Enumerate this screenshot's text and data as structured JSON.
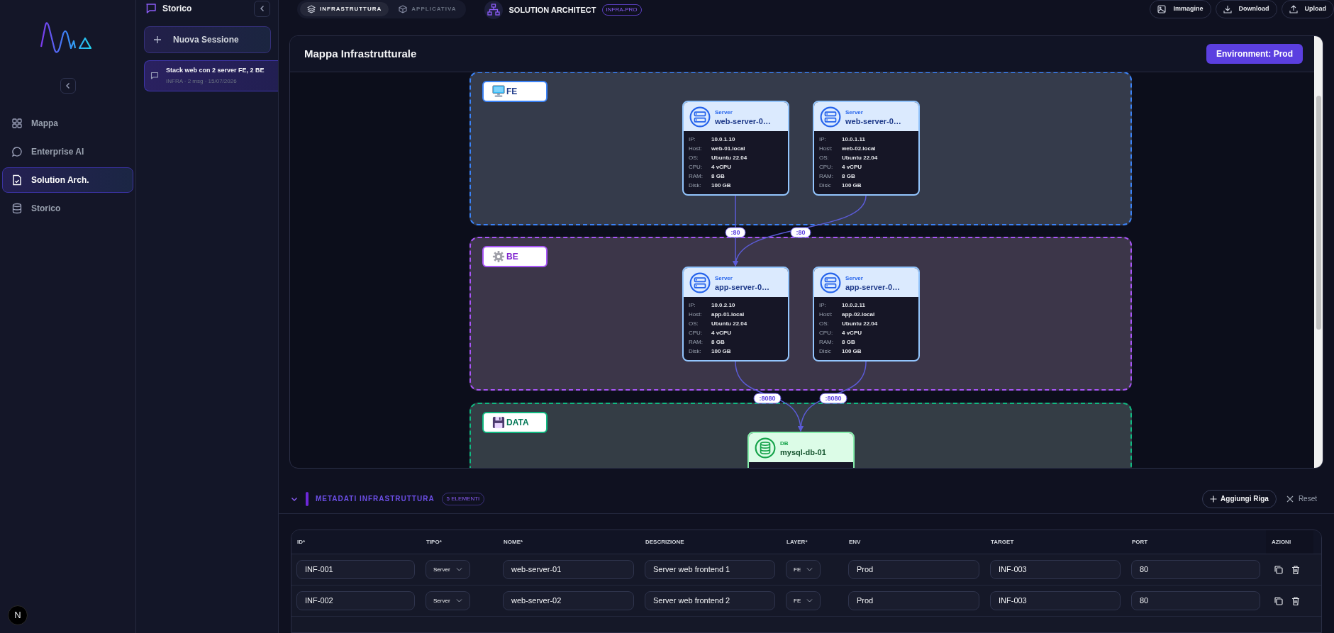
{
  "nav": {
    "items": [
      {
        "label": "Mappa",
        "selected": false
      },
      {
        "label": "Enterprise AI",
        "selected": false
      },
      {
        "label": "Solution Arch.",
        "selected": true
      },
      {
        "label": "Storico",
        "selected": false
      }
    ],
    "avatar": "N"
  },
  "history": {
    "title": "Storico",
    "new_session": "Nuova Sessione",
    "sessions": [
      {
        "title": "Stack web con 2 server FE, 2 BE",
        "meta": "INFRA · 2 msg · 15/07/2026",
        "selected": true
      }
    ]
  },
  "topbar": {
    "view_tabs": [
      {
        "label": "INFRASTRUTTURA",
        "selected": true
      },
      {
        "label": "APPLICATIVA",
        "selected": false
      }
    ],
    "title": "SOLUTION ARCHITECT",
    "badge": "INFRA-PRO",
    "actions": [
      {
        "label": "Immagine"
      },
      {
        "label": "Download"
      },
      {
        "label": "Upload"
      }
    ]
  },
  "map": {
    "title": "Mappa Infrastrutturale",
    "environment": "Environment: Prod",
    "groups": [
      {
        "label": "FE",
        "kind": "fe"
      },
      {
        "label": "BE",
        "kind": "be"
      },
      {
        "label": "DATA",
        "kind": "data"
      }
    ],
    "nodes": [
      {
        "type": "Server",
        "name": "web-server-0…",
        "kind": "server",
        "fields": [
          {
            "label": "IP:",
            "value": "10.0.1.10"
          },
          {
            "label": "Host:",
            "value": "web-01.local"
          },
          {
            "label": "OS:",
            "value": "Ubuntu 22.04"
          },
          {
            "label": "CPU:",
            "value": "4 vCPU"
          },
          {
            "label": "RAM:",
            "value": "8 GB"
          },
          {
            "label": "Disk:",
            "value": "100 GB"
          }
        ]
      },
      {
        "type": "Server",
        "name": "web-server-0…",
        "kind": "server",
        "fields": [
          {
            "label": "IP:",
            "value": "10.0.1.11"
          },
          {
            "label": "Host:",
            "value": "web-02.local"
          },
          {
            "label": "OS:",
            "value": "Ubuntu 22.04"
          },
          {
            "label": "CPU:",
            "value": "4 vCPU"
          },
          {
            "label": "RAM:",
            "value": "8 GB"
          },
          {
            "label": "Disk:",
            "value": "100 GB"
          }
        ]
      },
      {
        "type": "Server",
        "name": "app-server-0…",
        "kind": "server",
        "fields": [
          {
            "label": "IP:",
            "value": "10.0.2.10"
          },
          {
            "label": "Host:",
            "value": "app-01.local"
          },
          {
            "label": "OS:",
            "value": "Ubuntu 22.04"
          },
          {
            "label": "CPU:",
            "value": "4 vCPU"
          },
          {
            "label": "RAM:",
            "value": "8 GB"
          },
          {
            "label": "Disk:",
            "value": "100 GB"
          }
        ]
      },
      {
        "type": "Server",
        "name": "app-server-0…",
        "kind": "server",
        "fields": [
          {
            "label": "IP:",
            "value": "10.0.2.11"
          },
          {
            "label": "Host:",
            "value": "app-02.local"
          },
          {
            "label": "OS:",
            "value": "Ubuntu 22.04"
          },
          {
            "label": "CPU:",
            "value": "4 vCPU"
          },
          {
            "label": "RAM:",
            "value": "8 GB"
          },
          {
            "label": "Disk:",
            "value": "100 GB"
          }
        ]
      },
      {
        "type": "DB",
        "name": "mysql-db-01",
        "kind": "database"
      }
    ],
    "edges": [
      {
        "label": ":80"
      },
      {
        "label": ":80"
      },
      {
        "label": ":8080"
      },
      {
        "label": ":8080"
      }
    ]
  },
  "metadata": {
    "title": "METADATI INFRASTRUTTURA",
    "count": "5 ELEMENTI",
    "add_button": "Aggiungi Riga",
    "reset_button": "Reset",
    "columns": [
      {
        "label": "ID*",
        "kind": "input"
      },
      {
        "label": "TIPO*",
        "kind": "select"
      },
      {
        "label": "NOME*",
        "kind": "input"
      },
      {
        "label": "DESCRIZIONE",
        "kind": "input"
      },
      {
        "label": "LAYER*",
        "kind": "select"
      },
      {
        "label": "ENV",
        "kind": "input"
      },
      {
        "label": "TARGET",
        "kind": "input"
      },
      {
        "label": "PORT",
        "kind": "input"
      },
      {
        "label": "AZIONI",
        "kind": "actions"
      }
    ],
    "rows": [
      {
        "cells": [
          "INF-001",
          "Server",
          "web-server-01",
          "Server web frontend 1",
          "FE",
          "Prod",
          "INF-003",
          "80"
        ]
      },
      {
        "cells": [
          "INF-002",
          "Server",
          "web-server-02",
          "Server web frontend 2",
          "FE",
          "Prod",
          "INF-003",
          "80"
        ]
      }
    ]
  }
}
